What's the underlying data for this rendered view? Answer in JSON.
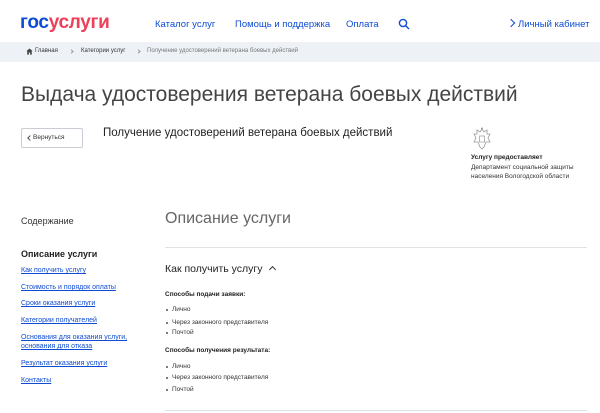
{
  "header": {
    "logo_gos": "гос",
    "logo_usl": "услуги",
    "nav": [
      "Каталог услуг",
      "Помощь и поддержка",
      "Оплата"
    ],
    "cabinet": "Личный кабинет"
  },
  "breadcrumb": [
    "Главная",
    "Категории услуг",
    "Получение удостоверений ветерана боевых действий"
  ],
  "page": {
    "title": "Выдача удостоверения ветерана боевых действий",
    "back": "Вернуться",
    "subtitle": "Получение удостоверений ветерана боевых действий",
    "provider_heading": "Услугу предоставляет",
    "provider": "Департамент социальной защиты населения Вологодской области"
  },
  "sidebar": {
    "contents": "Содержание",
    "heading": "Описание услуги",
    "links": [
      "Как получить услугу",
      "Стоимость и порядок оплаты",
      "Сроки оказания услуги",
      "Категории получателей",
      "Основания для оказания услуги, основания для отказа",
      "Результат оказания услуги",
      "Контакты"
    ]
  },
  "main": {
    "section_title": "Описание услуги",
    "how_title": "Как получить услугу",
    "submit_heading": "Способы подачи заявки:",
    "submit_items": [
      "Лично",
      "Через законного представителя",
      "Почтой"
    ],
    "result_heading": "Способы получения результата:",
    "result_items": [
      "Лично",
      "Через законного представителя",
      "Почтой"
    ]
  },
  "colors": {
    "brand_blue": "#0d4cd3",
    "brand_red": "#ee3f58"
  },
  "icons": {
    "search": "search-icon",
    "home": "home-icon",
    "emblem": "coat-of-arms-icon"
  }
}
